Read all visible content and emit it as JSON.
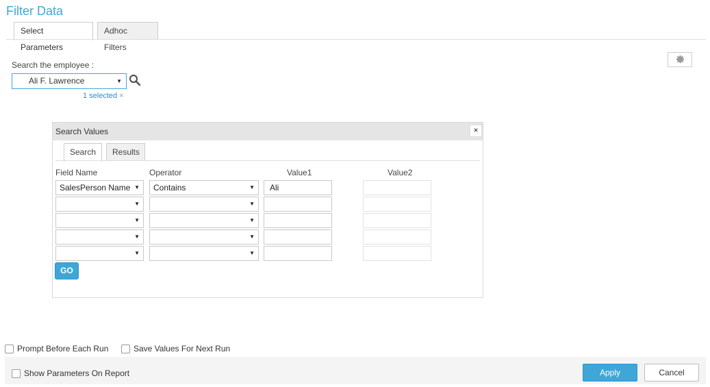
{
  "title": "Filter Data",
  "tabs": [
    {
      "label": "Select Parameters",
      "active": true
    },
    {
      "label": "Adhoc Filters",
      "active": false
    }
  ],
  "employee": {
    "label": "Search the employee :",
    "value": "Ali F. Lawrence",
    "selected_text": "1 selected",
    "clear_symbol": "×"
  },
  "dialog": {
    "title": "Search Values",
    "close_symbol": "×",
    "tabs": [
      {
        "label": "Search",
        "active": true
      },
      {
        "label": "Results",
        "active": false
      }
    ],
    "columns": {
      "field": "Field Name",
      "operator": "Operator",
      "value1": "Value1",
      "value2": "Value2"
    },
    "rows": [
      {
        "field": "SalesPerson Name",
        "operator": "Contains",
        "value1": "Ali",
        "value2": ""
      },
      {
        "field": "",
        "operator": "",
        "value1": "",
        "value2": ""
      },
      {
        "field": "",
        "operator": "",
        "value1": "",
        "value2": ""
      },
      {
        "field": "",
        "operator": "",
        "value1": "",
        "value2": ""
      },
      {
        "field": "",
        "operator": "",
        "value1": "",
        "value2": ""
      }
    ],
    "go_label": "GO"
  },
  "options": {
    "prompt_before_run": "Prompt Before Each Run",
    "save_values": "Save Values For Next Run",
    "show_params": "Show Parameters On Report"
  },
  "buttons": {
    "apply": "Apply",
    "cancel": "Cancel"
  },
  "colors": {
    "accent": "#3ea7d8",
    "link": "#2a8fd0"
  }
}
